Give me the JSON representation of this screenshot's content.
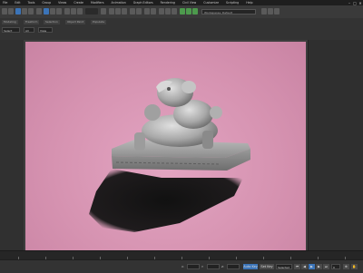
{
  "menubar": {
    "items": [
      "File",
      "Edit",
      "Tools",
      "Group",
      "Views",
      "Create",
      "Modifiers",
      "Animation",
      "Graph Editors",
      "Rendering",
      "Civil View",
      "Customize",
      "Scripting",
      "Help"
    ],
    "minimize": "–",
    "maximize": "□",
    "close": "✕"
  },
  "toolbar": {
    "workspace_label": "Workspaces: Default"
  },
  "ribbon": {
    "tabs": [
      "Modeling",
      "Freeform",
      "Selection",
      "Object Paint",
      "Populate"
    ],
    "fields": [
      "Select",
      "All",
      "View"
    ]
  },
  "status": {
    "x_label": "X:",
    "y_label": "Y:",
    "z_label": "Z:",
    "auto_key": "Auto Key",
    "set_key": "Set Key",
    "selected": "Selected",
    "frame": "0"
  },
  "colors": {
    "background": "#d693b1",
    "accent": "#3b74b8"
  }
}
